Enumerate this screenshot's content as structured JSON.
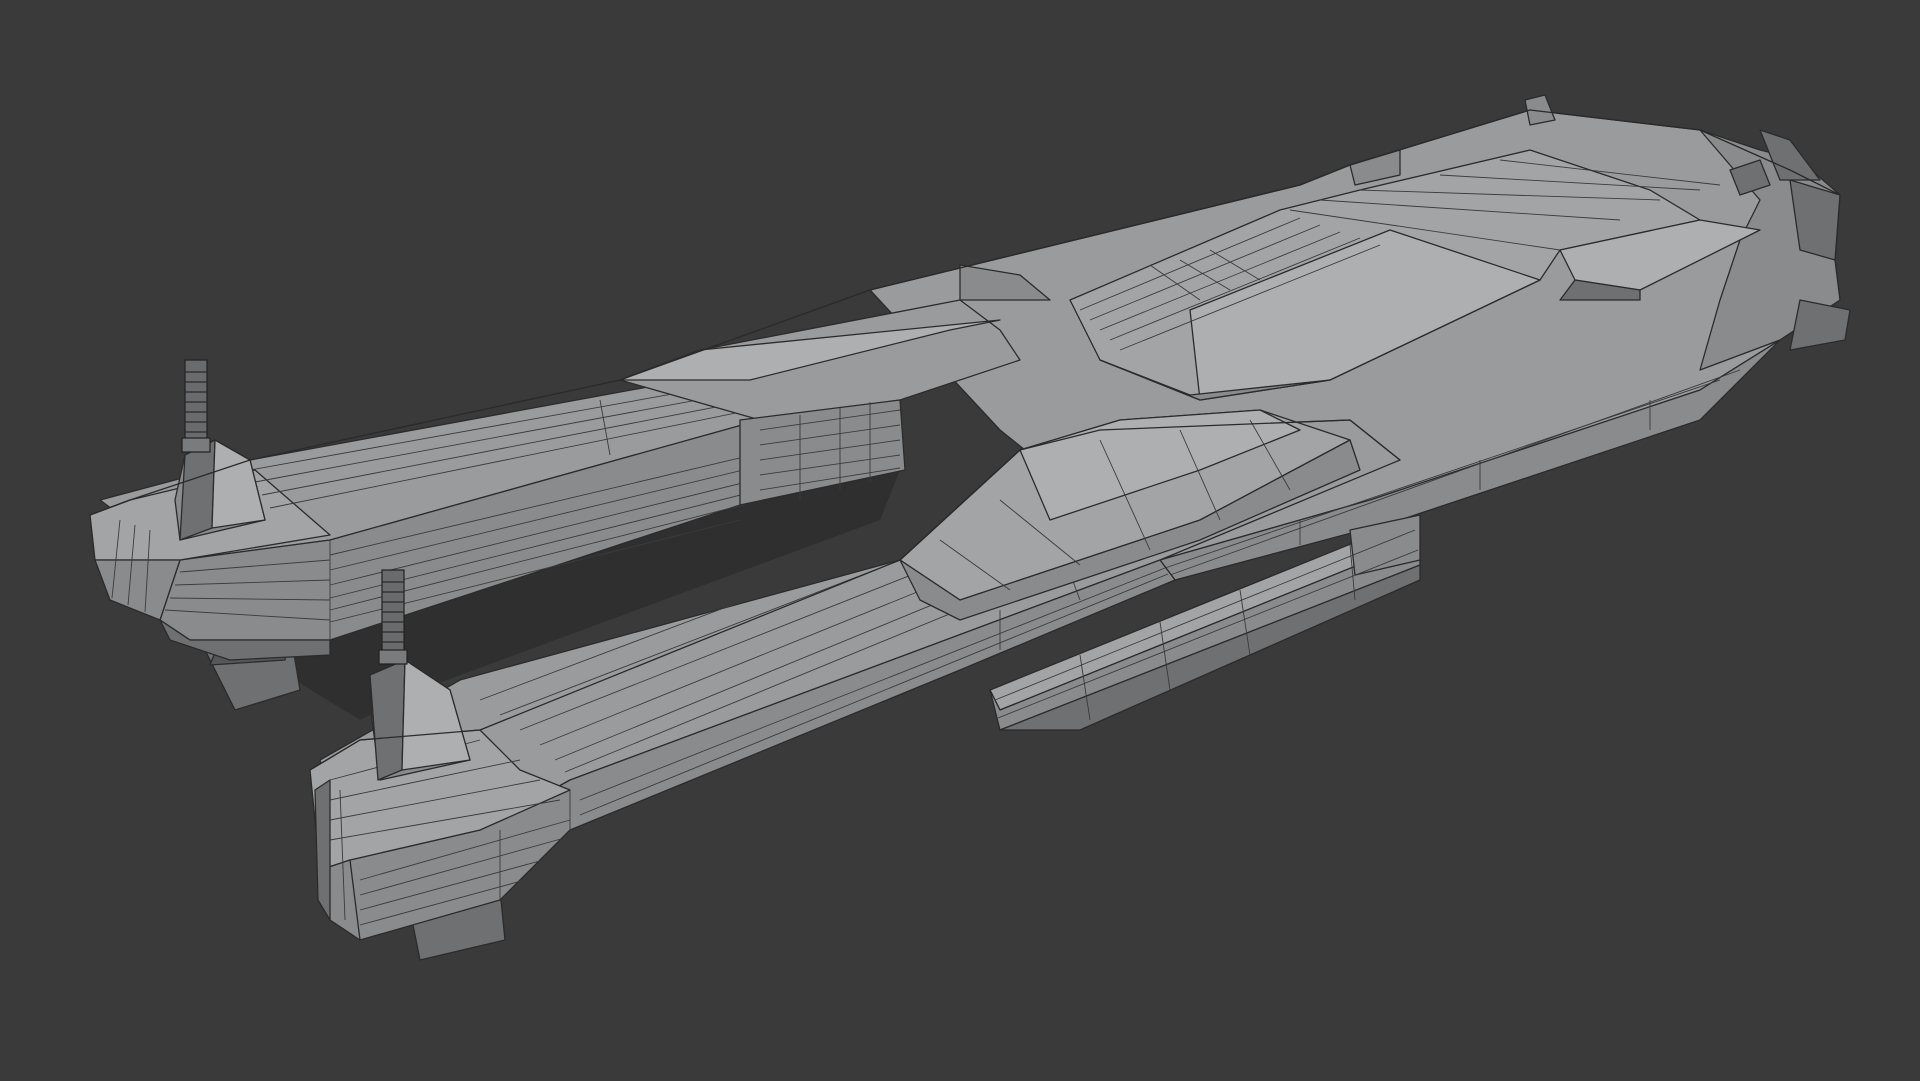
{
  "viewport": {
    "background_color": "#3a3a3a",
    "model_base_color": "#9a9b9c",
    "wire_color": "#2b2b2b"
  },
  "model": {
    "subject": "starship-hull",
    "display_mode": "solid-with-wireframe",
    "parts": [
      "main-hull",
      "left-prong",
      "right-prong",
      "command-deck",
      "antenna-left",
      "antenna-right",
      "side-fin",
      "stern-engines"
    ]
  }
}
